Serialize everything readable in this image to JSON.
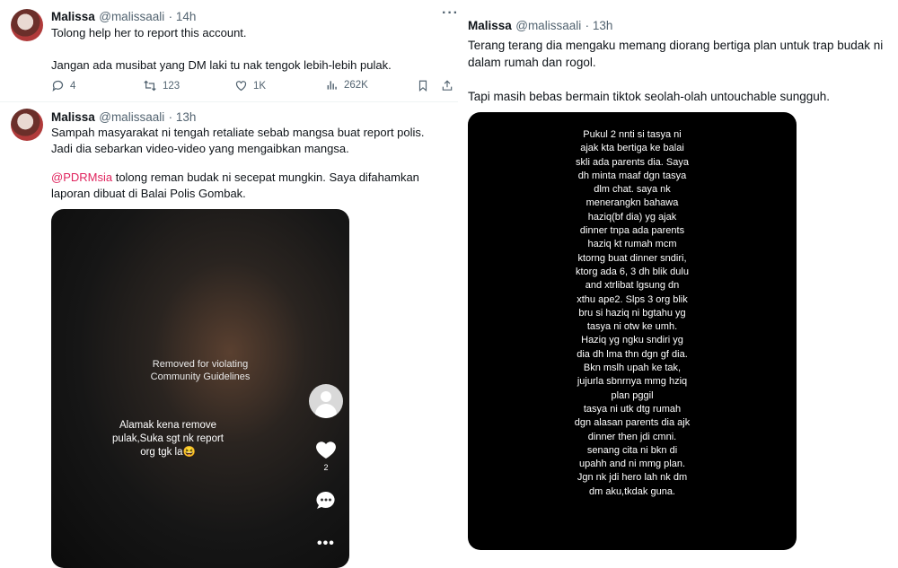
{
  "tweet1": {
    "name": "Malissa",
    "handle": "@malissaali",
    "time": "· 14h",
    "body": "Tolong help her to report this account.\n\nJangan ada musibat yang DM laki tu nak tengok lebih-lebih pulak.",
    "replies": "4",
    "retweets": "123",
    "likes": "1K",
    "views": "262K"
  },
  "tweet2": {
    "name": "Malissa",
    "handle": "@malissaali",
    "time": "· 13h",
    "body": "Sampah masyarakat ni tengah retaliate sebab mangsa buat report polis. Jadi dia sebarkan video-video yang mengaibkan mangsa.",
    "mention": "@PDRMsia",
    "body2": " tolong reman budak ni secepat mungkin. Saya difahamkan laporan dibuat di Balai Polis Gombak.",
    "video_notice": "Removed for violating\nCommunity Guidelines",
    "video_caption": "Alamak kena remove\npulak,Suka sgt nk report\norg tgk la😆",
    "video_likes": "2"
  },
  "tweet3": {
    "name": "Malissa",
    "handle": "@malissaali",
    "time": "· 13h",
    "body": "Terang terang dia mengaku memang diorang bertiga plan untuk trap budak ni dalam rumah dan rogol.\n\nTapi masih bebas bermain tiktok seolah-olah untouchable sungguh.",
    "screenshot_text": "Pukul 2 nnti si tasya ni\najak kta bertiga ke balai\nskli ada parents dia. Saya\ndh minta maaf dgn tasya\ndlm chat. saya nk\nmenerangkn bahawa\nhaziq(bf dia) yg ajak\ndinner tnpa ada parents\nhaziq kt rumah mcm\nktorng buat dinner sndiri,\nktorg ada 6, 3 dh blik dulu\nand xtrlibat lgsung dn\nxthu ape2. Slps 3 org blik\nbru si haziq ni bgtahu yg\ntasya ni otw ke umh.\nHaziq yg ngku sndiri yg\ndia dh lma thn dgn gf dia.\nBkn mslh upah ke tak,\njujurla sbnrnya mmg hziq\nplan pggil\ntasya ni utk dtg rumah\ndgn alasan parents dia ajk\ndinner then jdi cmni.\nsenang cita ni bkn di\nupahh and ni mmg plan.\nJgn nk jdi hero lah nk dm\ndm aku,tkdak guna."
  },
  "icons": {
    "more": "more-icon",
    "reply": "reply-icon",
    "retweet": "retweet-icon",
    "like": "heart-icon",
    "views": "views-icon",
    "bookmark": "bookmark-icon",
    "share": "share-icon"
  },
  "colors": {
    "mention": "#e0245e",
    "muted": "#536471",
    "text": "#0f1419"
  }
}
